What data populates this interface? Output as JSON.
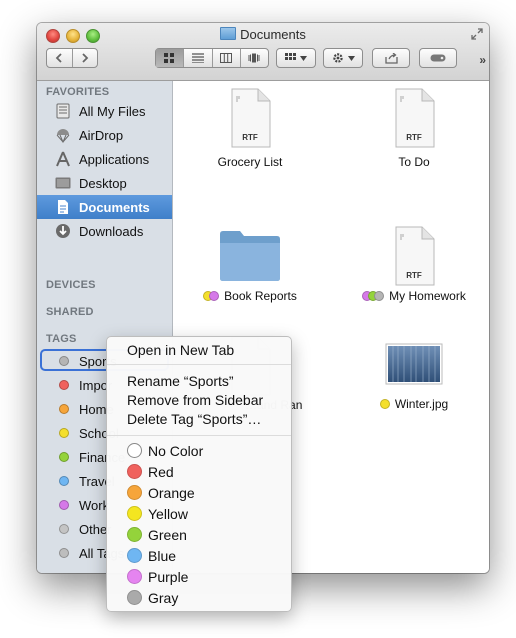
{
  "window": {
    "title": "Documents"
  },
  "toolbar": {
    "back_icon": "chevron-left-icon",
    "forward_icon": "chevron-right-icon",
    "view_modes": [
      "icon-view-icon",
      "list-view-icon",
      "column-view-icon",
      "cover-flow-icon"
    ],
    "arrange_icon": "grid-icon",
    "action_icon": "gear-icon",
    "share_icon": "share-icon",
    "tags_icon": "tag-icon",
    "overflow_glyph": "»"
  },
  "sidebar": {
    "favorites_header": "FAVORITES",
    "favorites": [
      {
        "label": "All My Files",
        "icon": "all-my-files-icon"
      },
      {
        "label": "AirDrop",
        "icon": "airdrop-icon"
      },
      {
        "label": "Applications",
        "icon": "applications-icon"
      },
      {
        "label": "Desktop",
        "icon": "desktop-icon"
      },
      {
        "label": "Documents",
        "icon": "documents-icon",
        "selected": true
      },
      {
        "label": "Downloads",
        "icon": "downloads-icon"
      }
    ],
    "devices_header": "DEVICES",
    "shared_header": "SHARED",
    "tags_header": "TAGS",
    "tags": [
      {
        "label": "Sports",
        "color": "#b5b5b5"
      },
      {
        "label": "Impor",
        "color": "#f0615d"
      },
      {
        "label": "Home",
        "color": "#f6a53a"
      },
      {
        "label": "School",
        "color": "#f4df2c"
      },
      {
        "label": "Finance",
        "color": "#94d33b"
      },
      {
        "label": "Travel",
        "color": "#6fb6f2"
      },
      {
        "label": "Work",
        "color": "#d579e8"
      },
      {
        "label": "Other",
        "color": "#c4c4c4"
      },
      {
        "label": "All Tags",
        "color": "#bdbdbd"
      }
    ]
  },
  "files": [
    {
      "name": "Grocery List",
      "kind": "RTF",
      "type": "document",
      "tags": []
    },
    {
      "name": "To Do",
      "kind": "RTF",
      "type": "document",
      "tags": []
    },
    {
      "name": "Book Reports",
      "type": "folder",
      "tags": [
        "#f4df2c",
        "#d579e8"
      ]
    },
    {
      "name": "My Homework",
      "kind": "RTF",
      "type": "document",
      "tags": [
        "#d579e8",
        "#94d33b",
        "#b5b5b5"
      ]
    },
    {
      "name": "…and Ran",
      "type": "document",
      "tags": []
    },
    {
      "name": "Winter.jpg",
      "type": "image",
      "tags": [
        "#f4df2c"
      ]
    }
  ],
  "context_menu": {
    "open_new_tab": "Open in New Tab",
    "rename": "Rename “Sports”",
    "remove": "Remove from Sidebar",
    "delete": "Delete Tag “Sports”…",
    "colors": [
      {
        "label": "No Color",
        "color": "#ffffff"
      },
      {
        "label": "Red",
        "color": "#f0615d"
      },
      {
        "label": "Orange",
        "color": "#f6a53a"
      },
      {
        "label": "Yellow",
        "color": "#f4e620"
      },
      {
        "label": "Green",
        "color": "#94d33b"
      },
      {
        "label": "Blue",
        "color": "#6fb6f2"
      },
      {
        "label": "Purple",
        "color": "#e584f0"
      },
      {
        "label": "Gray",
        "color": "#aaaaaa"
      }
    ]
  }
}
